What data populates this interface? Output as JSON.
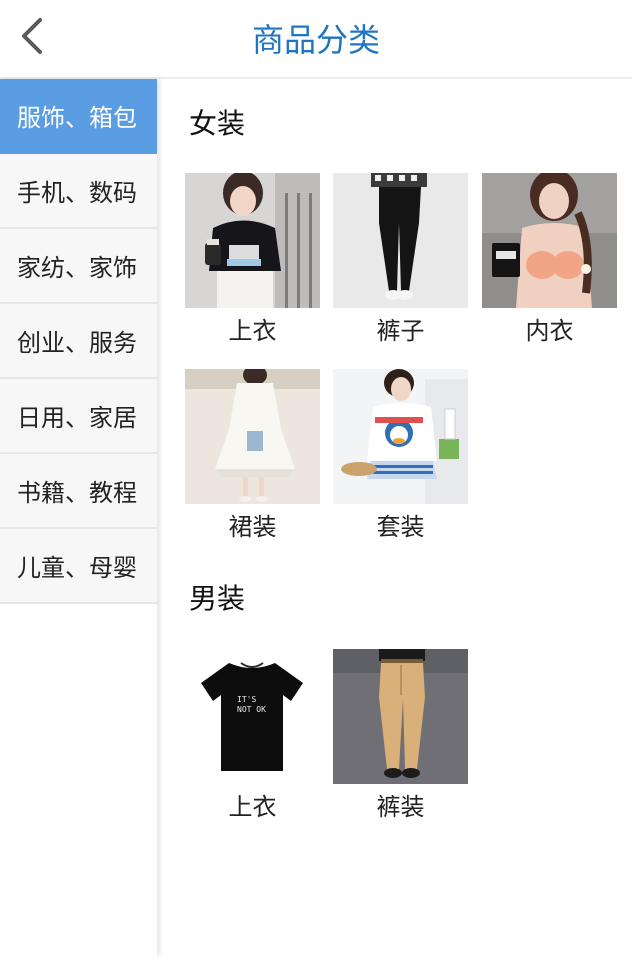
{
  "header": {
    "title": "商品分类",
    "title_color": "#1f74c4"
  },
  "sidebar": {
    "active_color": "#5b9de3",
    "items": [
      {
        "label": "服饰、箱包",
        "active": true
      },
      {
        "label": "手机、数码",
        "active": false
      },
      {
        "label": "家纺、家饰",
        "active": false
      },
      {
        "label": "创业、服务",
        "active": false
      },
      {
        "label": "日用、家居",
        "active": false
      },
      {
        "label": "书籍、教程",
        "active": false
      },
      {
        "label": "儿童、母婴",
        "active": false
      }
    ]
  },
  "sections": [
    {
      "title": "女装",
      "items": [
        {
          "label": "上衣",
          "icon": "womens-top-photo"
        },
        {
          "label": "裤子",
          "icon": "womens-pants-photo"
        },
        {
          "label": "内衣",
          "icon": "underwear-photo"
        },
        {
          "label": "裙装",
          "icon": "dress-photo"
        },
        {
          "label": "套装",
          "icon": "outfit-set-photo"
        }
      ]
    },
    {
      "title": "男装",
      "items": [
        {
          "label": "上衣",
          "icon": "mens-tshirt-photo",
          "print_text": "IT'S NOT OK"
        },
        {
          "label": "裤装",
          "icon": "mens-pants-photo"
        }
      ]
    }
  ]
}
